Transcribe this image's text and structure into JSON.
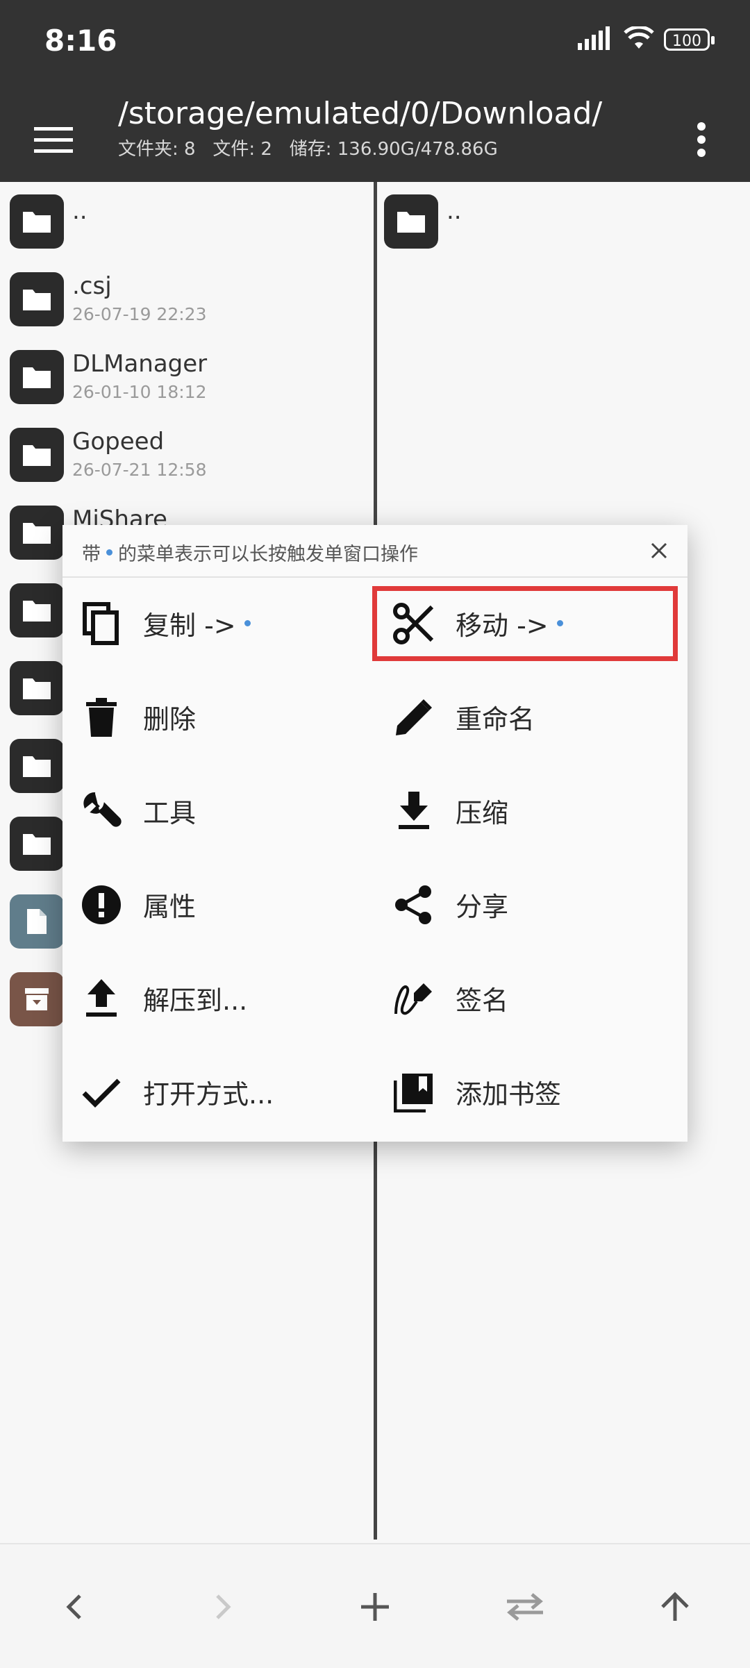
{
  "status": {
    "time": "8:16",
    "battery": "100"
  },
  "header": {
    "path": "/storage/emulated/0/Download/",
    "info": "文件夹: 8   文件: 2   储存: 136.90G/478.86G"
  },
  "left_pane": {
    "items": [
      {
        "name": "..",
        "date": ""
      },
      {
        "name": ".csj",
        "date": "26-07-19 22:23"
      },
      {
        "name": "DLManager",
        "date": "26-01-10 18:12"
      },
      {
        "name": "Gopeed",
        "date": "26-07-21 12:58"
      },
      {
        "name": "MiShare",
        "date": ""
      }
    ]
  },
  "right_pane": {
    "items": [
      {
        "name": ".."
      }
    ]
  },
  "dialog": {
    "hint_before": "带",
    "hint_after": "的菜单表示可以长按触发单窗口操作",
    "items": [
      {
        "label": "复制 ->",
        "icon": "copy-icon"
      },
      {
        "label": "移动 ->",
        "icon": "cut-icon"
      },
      {
        "label": "删除",
        "icon": "trash-icon"
      },
      {
        "label": "重命名",
        "icon": "pencil-icon"
      },
      {
        "label": "工具",
        "icon": "wrench-icon"
      },
      {
        "label": "压缩",
        "icon": "download-icon"
      },
      {
        "label": "属性",
        "icon": "info-icon"
      },
      {
        "label": "分享",
        "icon": "share-icon"
      },
      {
        "label": "解压到...",
        "icon": "upload-icon"
      },
      {
        "label": "签名",
        "icon": "signature-icon"
      },
      {
        "label": "打开方式...",
        "icon": "check-icon"
      },
      {
        "label": "添加书签",
        "icon": "bookmark-icon"
      }
    ]
  },
  "colors": {
    "accent_dot": "#4a90d9",
    "highlight": "#e03a3a",
    "toolbar": "#333333"
  }
}
